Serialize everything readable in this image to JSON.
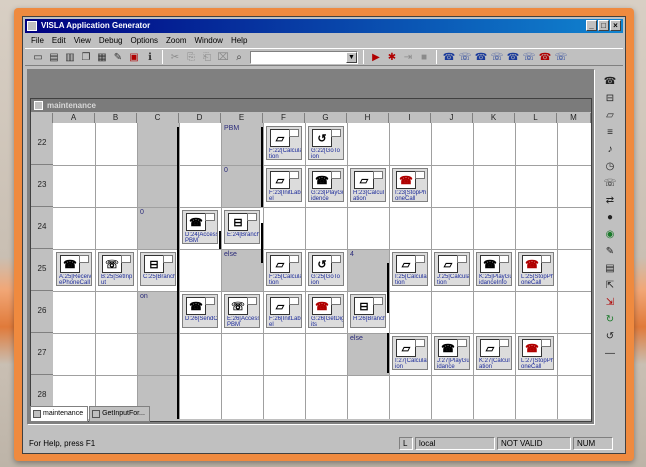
{
  "app": {
    "title": "VISLA Application Generator",
    "min": "_",
    "max": "□",
    "close": "×"
  },
  "menu": [
    "File",
    "Edit",
    "View",
    "Debug",
    "Options",
    "Zoom",
    "Window",
    "Help"
  ],
  "toolbar": {
    "combo_value": "",
    "combo_arrow": "▼"
  },
  "child": {
    "title": "maintenance"
  },
  "columns": [
    "A",
    "B",
    "C",
    "D",
    "E",
    "F",
    "G",
    "H",
    "I",
    "J",
    "K",
    "L",
    "M"
  ],
  "rows": [
    "22",
    "23",
    "24",
    "25",
    "26",
    "27",
    "28"
  ],
  "labels": {
    "pbm": "PBM",
    "zero": "0",
    "zero2": "0",
    "else1": "else",
    "four": "4",
    "on": "on",
    "else2": "else"
  },
  "nodes": [
    {
      "label": "F:22[Calcula tion",
      "icon": "calc"
    },
    {
      "label": "G:22[GoTo ion",
      "icon": "goto"
    },
    {
      "label": "F:23[InitLab el",
      "icon": "calc"
    },
    {
      "label": "G:23[PlayGu idence",
      "icon": "phone"
    },
    {
      "label": "H:23[Calcul ation",
      "icon": "calc"
    },
    {
      "label": "I:23[StopPh oneCall",
      "icon": "stop"
    },
    {
      "label": "D:24[Access PBM",
      "icon": "phone"
    },
    {
      "label": "E:24[Branch",
      "icon": "branch"
    },
    {
      "label": "A:25[Receiv ePhoneCall",
      "icon": "phone"
    },
    {
      "label": "B:25[SetInp ut",
      "icon": "phone"
    },
    {
      "label": "C:25[Branch",
      "icon": "branch"
    },
    {
      "label": "F:25[Calcula tion",
      "icon": "calc"
    },
    {
      "label": "G:25[GoTo ion",
      "icon": "goto"
    },
    {
      "label": "I:25[Calcula tion",
      "icon": "calc"
    },
    {
      "label": "J:25[Calcula tion",
      "icon": "calc"
    },
    {
      "label": "K:25[PlayGu idanceInfo",
      "icon": "phone"
    },
    {
      "label": "L:25[StopPh oneCall",
      "icon": "stop"
    },
    {
      "label": "D:26[SendC",
      "icon": "phone"
    },
    {
      "label": "E:26[Access PBM",
      "icon": "phone"
    },
    {
      "label": "F:26[InitLab el",
      "icon": "calc"
    },
    {
      "label": "G:26[GetDig its",
      "icon": "phone"
    },
    {
      "label": "H:26[Branch",
      "icon": "branch"
    },
    {
      "label": "I:27[Calculat ion",
      "icon": "calc"
    },
    {
      "label": "J:27[PlayGu idance",
      "icon": "phone"
    },
    {
      "label": "K:27[Calcul ation",
      "icon": "calc"
    },
    {
      "label": "L:27[StopPh oneCall",
      "icon": "stop"
    }
  ],
  "tabs": [
    {
      "label": "maintenance"
    },
    {
      "label": "GetInputFor..."
    }
  ],
  "status": {
    "help": "For Help, press F1",
    "mode": "L",
    "loc": "local",
    "valid": "NOT VALID",
    "num": "NUM"
  },
  "colors": {
    "frame": "#ef8a3f",
    "title_active": "#000080",
    "node_label": "#1b2a9a"
  }
}
